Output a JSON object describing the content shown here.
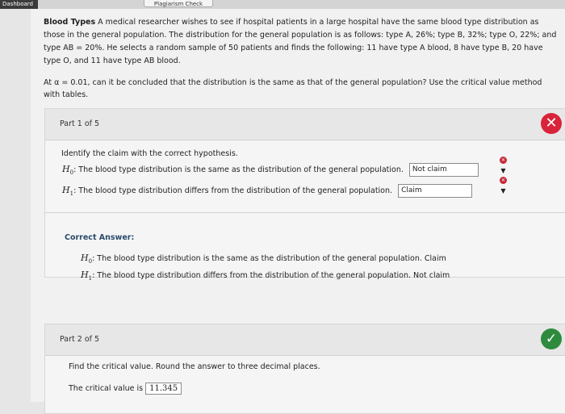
{
  "nav": {
    "dashboard_label": "Dashboard",
    "plagiarism_label": "Plagiarism Check"
  },
  "problem": {
    "title": "Blood Types",
    "text": "A medical researcher wishes to see if hospital patients in a large hospital have the same blood type distribution as those in the general population. The distribution for the general population is as follows: type A, 26%; type B, 32%; type O, 22%; and type AB = 20%. He selects a random sample of 50 patients and finds the following: 11 have type A blood, 8 have type B, 20 have type O, and 11 have type AB blood.",
    "question": "At α = 0.01, can it be concluded that the distribution is the same as that of the general population? Use the critical value method with tables."
  },
  "part1": {
    "title": "Part 1 of 5",
    "status_icon": "x-icon",
    "status_color": "#d9233a",
    "prompt": "Identify the claim with the correct hypothesis.",
    "h0_symbol": "H",
    "h0_sub": "0",
    "h0_text": ": The blood type distribution is the same as the distribution of the general population.",
    "h0_selected": "Not claim",
    "h1_symbol": "H",
    "h1_sub": "1",
    "h1_text": ": The blood type distribution differs from the distribution of the general population.",
    "h1_selected": "Claim",
    "correct_label": "Correct Answer:",
    "correct_h0_text": ": The blood type distribution is the same as the distribution of the general population. Claim",
    "correct_h1_text": ": The blood type distribution differs from the distribution of the general population. Not claim"
  },
  "part2": {
    "title": "Part 2 of 5",
    "status_icon": "check-icon",
    "status_color": "#2e8b3e",
    "prompt": "Find the critical value. Round the answer to three decimal places.",
    "crit_label": "The critical value is",
    "crit_value": "11.345"
  }
}
